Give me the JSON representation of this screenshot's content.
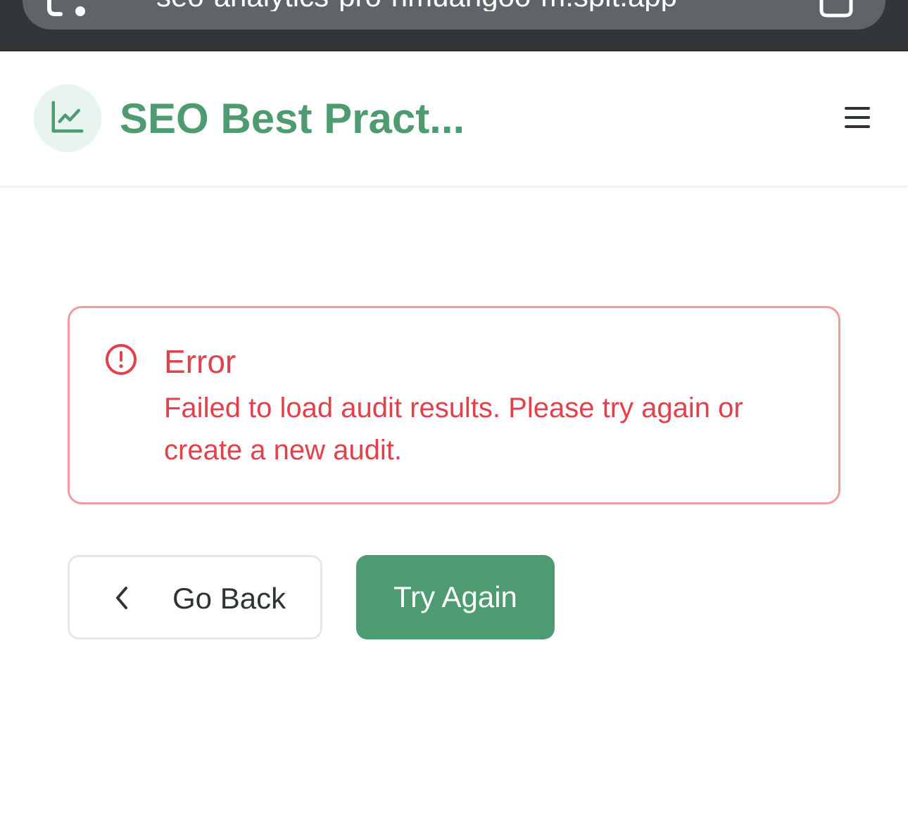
{
  "browser": {
    "url": "seo-analytics-pro-nmuangoo-m.spit.app",
    "site_icon": "site-settings-icon",
    "tabs_icon": "tabs-icon"
  },
  "header": {
    "logo_icon": "chart-line-icon",
    "title": "SEO Best Pract...",
    "menu_icon": "hamburger-menu-icon"
  },
  "error": {
    "icon": "alert-circle-icon",
    "title": "Error",
    "message": "Failed to load audit results. Please try again or create a new audit."
  },
  "actions": {
    "back_icon": "chevron-left-icon",
    "back_label": "Go Back",
    "retry_label": "Try Again"
  },
  "colors": {
    "brand": "#4e9b72",
    "error": "#e0414b",
    "error_border": "#f19a9f"
  }
}
